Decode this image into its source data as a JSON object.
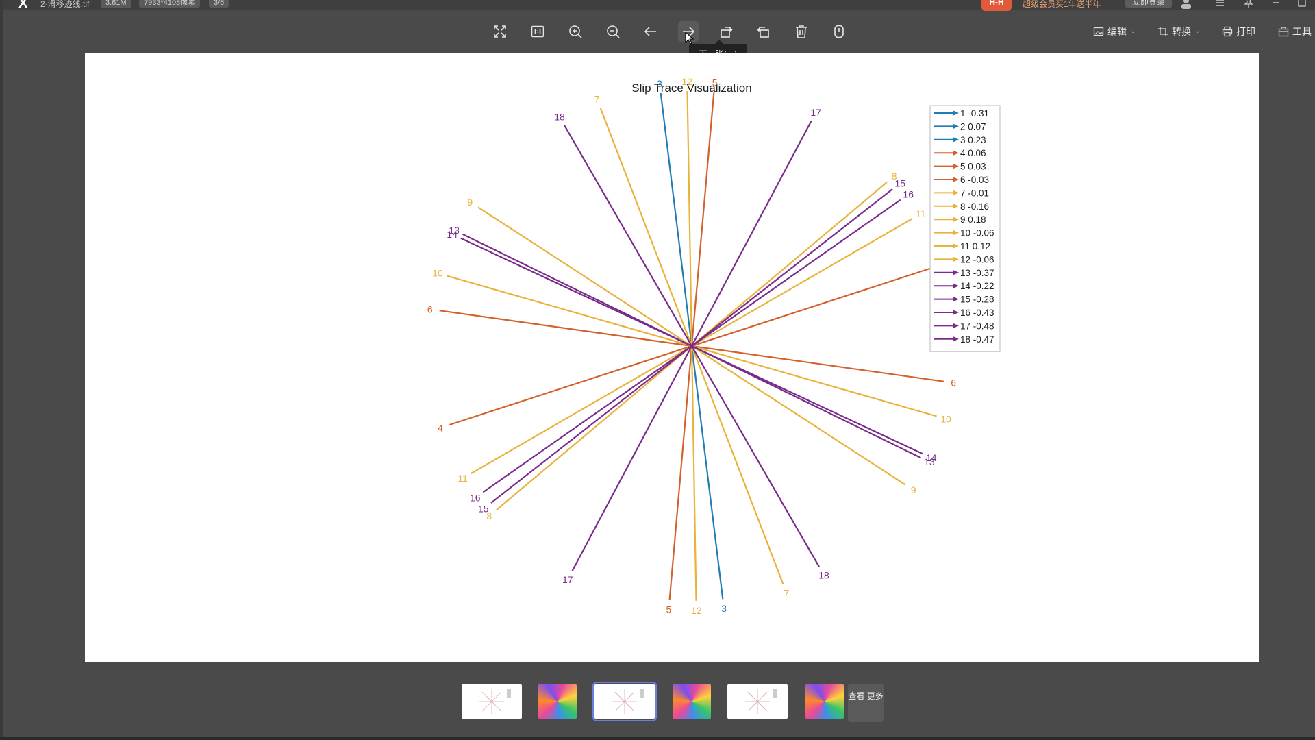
{
  "titlebar": {
    "filename": "2-滑移迹线.tif",
    "filesize": "3.61M",
    "dimensions": "7933*4108像素",
    "page": "3/6",
    "vip_badge": "H-H",
    "vip_promo": "超级会员买1年送半年",
    "login": "立即登录"
  },
  "toolbar": {
    "icons": [
      "fullscreen-icon",
      "actual-size-icon",
      "zoom-in-icon",
      "zoom-out-icon",
      "previous-icon",
      "next-icon",
      "rotate-left-icon",
      "rotate-right-icon",
      "delete-icon",
      "info-icon"
    ],
    "tooltip": "下一张(→)",
    "edit": "编辑",
    "convert": "转换",
    "print": "打印",
    "tools": "工具"
  },
  "colors": {
    "blue": "#1f7cb5",
    "orange": "#d4602a",
    "yellow": "#e9b23a",
    "purple": "#7a2c8c"
  },
  "thumbnails": {
    "types": [
      "white",
      "color",
      "white",
      "color",
      "white",
      "color"
    ],
    "selected_index": 2,
    "more": "查看 更多"
  },
  "chart_data": {
    "type": "line",
    "title": "Slip Trace Visualization",
    "traces": [
      {
        "id": 1,
        "value": -0.31,
        "color": "#1f7cb5",
        "angle_deg": 97
      },
      {
        "id": 2,
        "value": 0.07,
        "color": "#1f7cb5",
        "angle_deg": 97
      },
      {
        "id": 3,
        "value": 0.23,
        "color": "#1f7cb5",
        "angle_deg": 97
      },
      {
        "id": 4,
        "value": 0.06,
        "color": "#d4602a",
        "angle_deg": 18
      },
      {
        "id": 5,
        "value": 0.03,
        "color": "#d4602a",
        "angle_deg": 85
      },
      {
        "id": 6,
        "value": -0.03,
        "color": "#d4602a",
        "angle_deg": 172
      },
      {
        "id": 7,
        "value": -0.01,
        "color": "#e9b23a",
        "angle_deg": 111
      },
      {
        "id": 8,
        "value": -0.16,
        "color": "#e9b23a",
        "angle_deg": 40
      },
      {
        "id": 9,
        "value": 0.18,
        "color": "#e9b23a",
        "angle_deg": 147
      },
      {
        "id": 10,
        "value": -0.06,
        "color": "#e9b23a",
        "angle_deg": 164
      },
      {
        "id": 11,
        "value": 0.12,
        "color": "#e9b23a",
        "angle_deg": 30
      },
      {
        "id": 12,
        "value": -0.06,
        "color": "#e9b23a",
        "angle_deg": 91
      },
      {
        "id": 13,
        "value": -0.37,
        "color": "#7a2c8c",
        "angle_deg": 154
      },
      {
        "id": 14,
        "value": -0.22,
        "color": "#7a2c8c",
        "angle_deg": 155
      },
      {
        "id": 15,
        "value": -0.28,
        "color": "#7a2c8c",
        "angle_deg": 38
      },
      {
        "id": 16,
        "value": -0.43,
        "color": "#7a2c8c",
        "angle_deg": 35
      },
      {
        "id": 17,
        "value": -0.48,
        "color": "#7a2c8c",
        "angle_deg": 62
      },
      {
        "id": 18,
        "value": -0.47,
        "color": "#7a2c8c",
        "angle_deg": 120
      }
    ],
    "labels_at_ends": [
      {
        "text": "3",
        "end": "+"
      },
      {
        "text": "3",
        "end": "-"
      },
      {
        "text": "12",
        "end": "+"
      },
      {
        "text": "12",
        "end": "-"
      },
      {
        "text": "5",
        "end": "+"
      },
      {
        "text": "5",
        "end": "-"
      },
      {
        "text": "17",
        "end": "+"
      },
      {
        "text": "17",
        "end": "-"
      },
      {
        "text": "7",
        "end": "+"
      },
      {
        "text": "7",
        "end": "-"
      },
      {
        "text": "18",
        "end": "+"
      },
      {
        "text": "18",
        "end": "-"
      },
      {
        "text": "8",
        "end": "+"
      },
      {
        "text": "8",
        "end": "-"
      },
      {
        "text": "15",
        "end": "+"
      },
      {
        "text": "15",
        "end": "-"
      },
      {
        "text": "16",
        "end": "+"
      },
      {
        "text": "16",
        "end": "-"
      },
      {
        "text": "11",
        "end": "+"
      },
      {
        "text": "11",
        "end": "-"
      },
      {
        "text": "9",
        "end": "+"
      },
      {
        "text": "9",
        "end": "-"
      },
      {
        "text": "13",
        "end": "+"
      },
      {
        "text": "13",
        "end": "-"
      },
      {
        "text": "14",
        "end": "+"
      },
      {
        "text": "14",
        "end": "-"
      },
      {
        "text": "10",
        "end": "+"
      },
      {
        "text": "10",
        "end": "-"
      },
      {
        "text": "6",
        "end": "+"
      },
      {
        "text": "6",
        "end": "-"
      },
      {
        "text": "4",
        "end": "-"
      }
    ],
    "legend": [
      {
        "label": "1 -0.31",
        "color": "#1f7cb5"
      },
      {
        "label": "2 0.07",
        "color": "#1f7cb5"
      },
      {
        "label": "3 0.23",
        "color": "#1f7cb5"
      },
      {
        "label": "4 0.06",
        "color": "#d4602a"
      },
      {
        "label": "5 0.03",
        "color": "#d4602a"
      },
      {
        "label": "6 -0.03",
        "color": "#d4602a"
      },
      {
        "label": "7 -0.01",
        "color": "#e9b23a"
      },
      {
        "label": "8 -0.16",
        "color": "#e9b23a"
      },
      {
        "label": "9 0.18",
        "color": "#e9b23a"
      },
      {
        "label": "10 -0.06",
        "color": "#e9b23a"
      },
      {
        "label": "11 0.12",
        "color": "#e9b23a"
      },
      {
        "label": "12 -0.06",
        "color": "#e9b23a"
      },
      {
        "label": "13 -0.37",
        "color": "#7a2c8c"
      },
      {
        "label": "14 -0.22",
        "color": "#7a2c8c"
      },
      {
        "label": "15 -0.28",
        "color": "#7a2c8c"
      },
      {
        "label": "16 -0.43",
        "color": "#7a2c8c"
      },
      {
        "label": "17 -0.48",
        "color": "#7a2c8c"
      },
      {
        "label": "18 -0.47",
        "color": "#7a2c8c"
      }
    ],
    "legend_position": "right"
  }
}
